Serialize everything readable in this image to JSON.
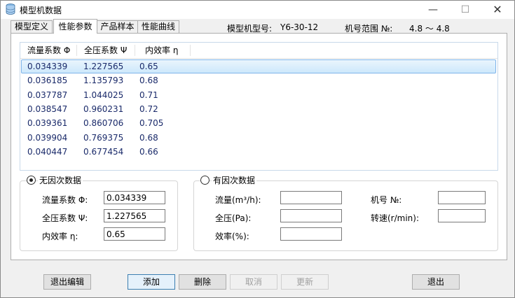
{
  "window": {
    "title": "模型机数据"
  },
  "tabs": [
    {
      "label": "模型定义"
    },
    {
      "label": "性能参数"
    },
    {
      "label": "产品样本"
    },
    {
      "label": "性能曲线"
    }
  ],
  "header": {
    "model_label": "模型机型号:",
    "model_value": "Y6-30-12",
    "range_label": "机号范围 №:",
    "range_value": "4.8 ～ 4.8"
  },
  "list": {
    "columns": [
      "流量系数 Φ",
      "全压系数 Ψ",
      "内效率 η"
    ],
    "rows": [
      [
        "0.034339",
        "1.227565",
        "0.65"
      ],
      [
        "0.036185",
        "1.135793",
        "0.68"
      ],
      [
        "0.037787",
        "1.044025",
        "0.71"
      ],
      [
        "0.038547",
        "0.960231",
        "0.72"
      ],
      [
        "0.039361",
        "0.860706",
        "0.705"
      ],
      [
        "0.039904",
        "0.769375",
        "0.68"
      ],
      [
        "0.040447",
        "0.677454",
        "0.66"
      ]
    ],
    "selected_index": 0
  },
  "dimensionless": {
    "title": "无因次数据",
    "selected": true,
    "flow_label": "流量系数 Φ:",
    "flow_value": "0.034339",
    "pressure_label": "全压系数 Ψ:",
    "pressure_value": "1.227565",
    "eff_label": "内效率 η:",
    "eff_value": "0.65"
  },
  "dimensional": {
    "title": "有因次数据",
    "selected": false,
    "flow_label": "流量(m³/h):",
    "flow_value": "",
    "pressure_label": "全压(Pa):",
    "pressure_value": "",
    "eff_label": "效率(%):",
    "eff_value": "",
    "no_label": "机号 №:",
    "no_value": "",
    "speed_label": "转速(r/min):",
    "speed_value": ""
  },
  "buttons": {
    "exit_edit": "退出编辑",
    "add": "添加",
    "delete": "删除",
    "cancel": "取消",
    "update": "更新",
    "exit": "退出"
  }
}
